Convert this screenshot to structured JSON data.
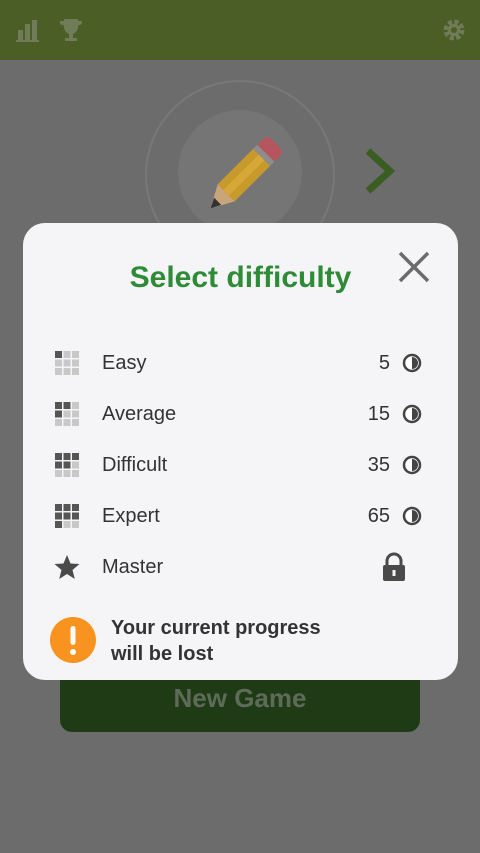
{
  "modal": {
    "title": "Select difficulty",
    "levels": [
      {
        "label": "Easy",
        "count": "5"
      },
      {
        "label": "Average",
        "count": "15"
      },
      {
        "label": "Difficult",
        "count": "35"
      },
      {
        "label": "Expert",
        "count": "65"
      },
      {
        "label": "Master",
        "locked": true
      }
    ],
    "warning": {
      "line1": "Your current progress",
      "line2": "will be lost"
    }
  },
  "background": {
    "new_game_label": "New Game"
  },
  "colors": {
    "accent_green": "#2e8b36",
    "topbar": "#4b5e25",
    "warning_orange": "#f7931e"
  },
  "icons": [
    "stats-icon",
    "trophy-icon",
    "settings-icon",
    "pencil-icon",
    "next-arrow-icon",
    "close-icon",
    "grid-icon",
    "coin-icon",
    "star-icon",
    "lock-icon",
    "warning-icon"
  ]
}
